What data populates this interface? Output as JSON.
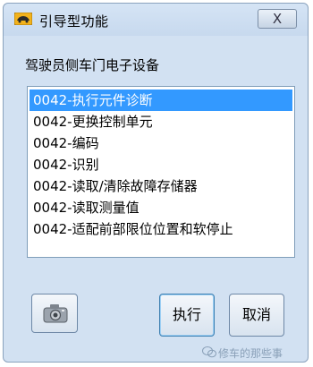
{
  "window": {
    "title": "引导型功能",
    "close_label": "X"
  },
  "dialog": {
    "section_label": "驾驶员侧车门电子设备",
    "list_items": [
      {
        "label": "0042-执行元件诊断",
        "selected": true
      },
      {
        "label": "0042-更换控制单元",
        "selected": false
      },
      {
        "label": "0042-编码",
        "selected": false
      },
      {
        "label": "0042-识别",
        "selected": false
      },
      {
        "label": "0042-读取/清除故障存储器",
        "selected": false
      },
      {
        "label": "0042-读取测量值",
        "selected": false
      },
      {
        "label": "0042-适配前部限位位置和软停止",
        "selected": false
      }
    ]
  },
  "buttons": {
    "execute_label": "执行",
    "cancel_label": "取消",
    "camera_icon": "camera-icon"
  },
  "watermark": {
    "text": "修车的那些事"
  },
  "colors": {
    "selection": "#3399ff",
    "window_bg": "#d2e1f2"
  }
}
